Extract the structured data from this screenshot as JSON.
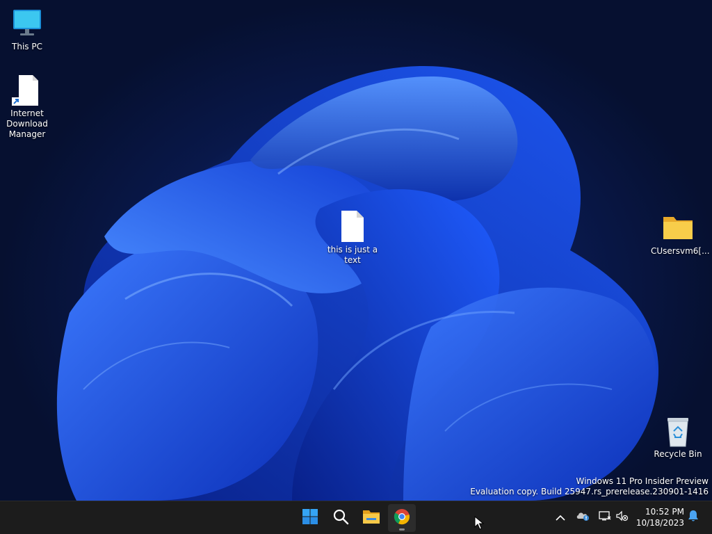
{
  "desktop": {
    "icons": [
      {
        "label": "This PC",
        "icon": "monitor-icon"
      },
      {
        "label": "Internet Download Manager",
        "icon": "shortcut-file-icon"
      },
      {
        "label": "this is just a text",
        "icon": "text-file-icon"
      },
      {
        "label": "CUsersvm6[...",
        "icon": "folder-icon"
      },
      {
        "label": "Recycle Bin",
        "icon": "recycle-bin-icon"
      }
    ],
    "watermark": {
      "line1": "Windows 11 Pro Insider Preview",
      "line2": "Evaluation copy. Build 25947.rs_prerelease.230901-1416"
    }
  },
  "taskbar": {
    "apps": [
      {
        "name": "Start",
        "icon": "windows-start-icon"
      },
      {
        "name": "Search",
        "icon": "search-icon"
      },
      {
        "name": "File Explorer",
        "icon": "file-explorer-icon"
      },
      {
        "name": "Google Chrome",
        "icon": "chrome-icon",
        "active": true
      }
    ],
    "tray": {
      "icons": [
        "chevron-up-icon",
        "onedrive-icon",
        "network-icon",
        "volume-muted-icon",
        "notification-bell-icon"
      ],
      "time": "10:52 PM",
      "date": "10/18/2023"
    }
  },
  "colors": {
    "taskbar_bg": "#1c1c1c",
    "accent_blue": "#1e88e5",
    "folder_yellow": "#f5c542"
  }
}
